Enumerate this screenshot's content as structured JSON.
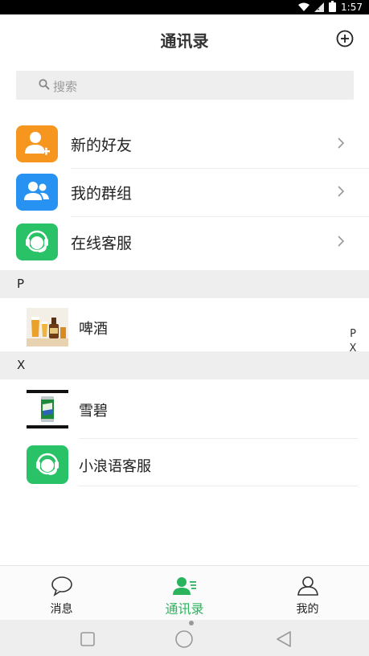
{
  "status_bar": {
    "time": "1:57",
    "icons": [
      "wifi-icon",
      "signal-icon",
      "battery-icon"
    ]
  },
  "header": {
    "title": "通讯录",
    "add_icon": "plus-circle-icon"
  },
  "search": {
    "placeholder": "搜索",
    "icon": "search-icon"
  },
  "functions": [
    {
      "label": "新的好友",
      "icon": "add-friend-icon",
      "color": "#f7961e"
    },
    {
      "label": "我的群组",
      "icon": "group-icon",
      "color": "#2792f1"
    },
    {
      "label": "在线客服",
      "icon": "customer-service-icon",
      "color": "#29c267"
    }
  ],
  "sections": [
    {
      "letter": "P",
      "contacts": [
        {
          "name": "啤酒",
          "avatar": "beer-photo"
        }
      ]
    },
    {
      "letter": "X",
      "contacts": [
        {
          "name": "雪碧",
          "avatar": "sprite-photo"
        },
        {
          "name": "小浪语客服",
          "avatar": "customer-service-icon"
        }
      ]
    }
  ],
  "index_letters": [
    "P",
    "X"
  ],
  "tabs": [
    {
      "label": "消息",
      "icon": "chat-bubble-icon",
      "active": false
    },
    {
      "label": "通讯录",
      "icon": "contacts-icon",
      "active": true
    },
    {
      "label": "我的",
      "icon": "profile-icon",
      "active": false
    }
  ],
  "nav_bar": {
    "buttons": [
      "recent-apps-icon",
      "home-icon",
      "back-icon"
    ]
  },
  "colors": {
    "accent": "#2bb35d",
    "section_bg": "#eeeeee"
  }
}
